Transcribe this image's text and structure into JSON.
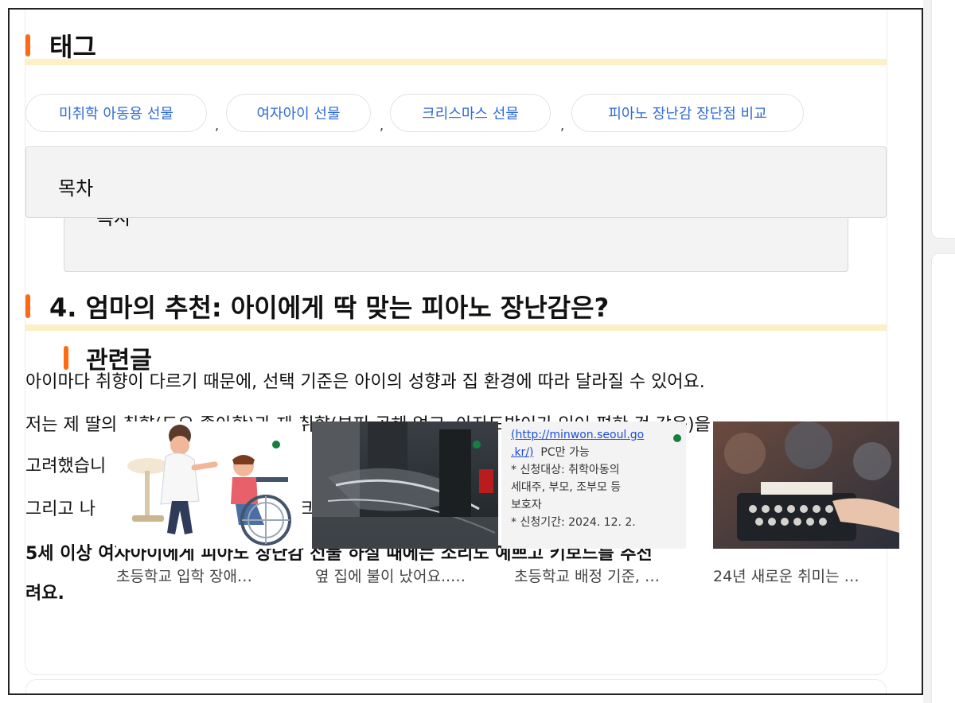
{
  "tags_section": {
    "heading": "태그"
  },
  "tags": [
    {
      "label": "미취학 아동용 선물"
    },
    {
      "label": "여자아이 선물"
    },
    {
      "label": "크리스마스 선물"
    },
    {
      "label": "피아노 장난감 장단점 비교"
    }
  ],
  "tag_separator": ",",
  "toc": {
    "title": "목차",
    "inner_title": "목차"
  },
  "section4": {
    "heading": "4. 엄마의 추천: 아이에게 딱 맞는 피아노 장난감은?"
  },
  "body": {
    "p1": "아이마다 취향이 다르기 때문에, 선택 기준은 아이의 성향과 집 환경에 따라 달라질 수 있어요.",
    "p2_line1": "저는 제 딸의 취향(도요 좋아함)과 제 취향(부피 공해 없고, 아자도발이가 있어 편한 것 같음)을",
    "p2_line2": "고려했습니",
    "p3": "그리고 나",
    "p3_tail": "크",
    "p4_line1": "5세 이상 여자아이에게 피아노 장난감 선물 하실 때에는 소리도 예쁘고 키보드를 추천",
    "p4_line2": "려요."
  },
  "related": {
    "heading": "관련글",
    "items": [
      {
        "caption": "초등학교 입학 장애…"
      },
      {
        "caption": "옆 집에 불이 났어요..…"
      },
      {
        "caption": "초등학교 배정 기준, …",
        "image_text": [
          "(http://minwon.seoul.go",
          ".kr/)",
          "PC만 가능",
          "* 신청대상: 취학아동의",
          "세대주, 부모, 조부모 등",
          "보호자",
          "* 신청기간: 2024. 12. 2."
        ]
      },
      {
        "caption": "24년 새로운 취미는 …"
      }
    ]
  },
  "colors": {
    "accent": "#ff6a13",
    "underline": "#fdefc6",
    "tag_text": "#2f6ad8",
    "link": "#1d4ed8"
  }
}
